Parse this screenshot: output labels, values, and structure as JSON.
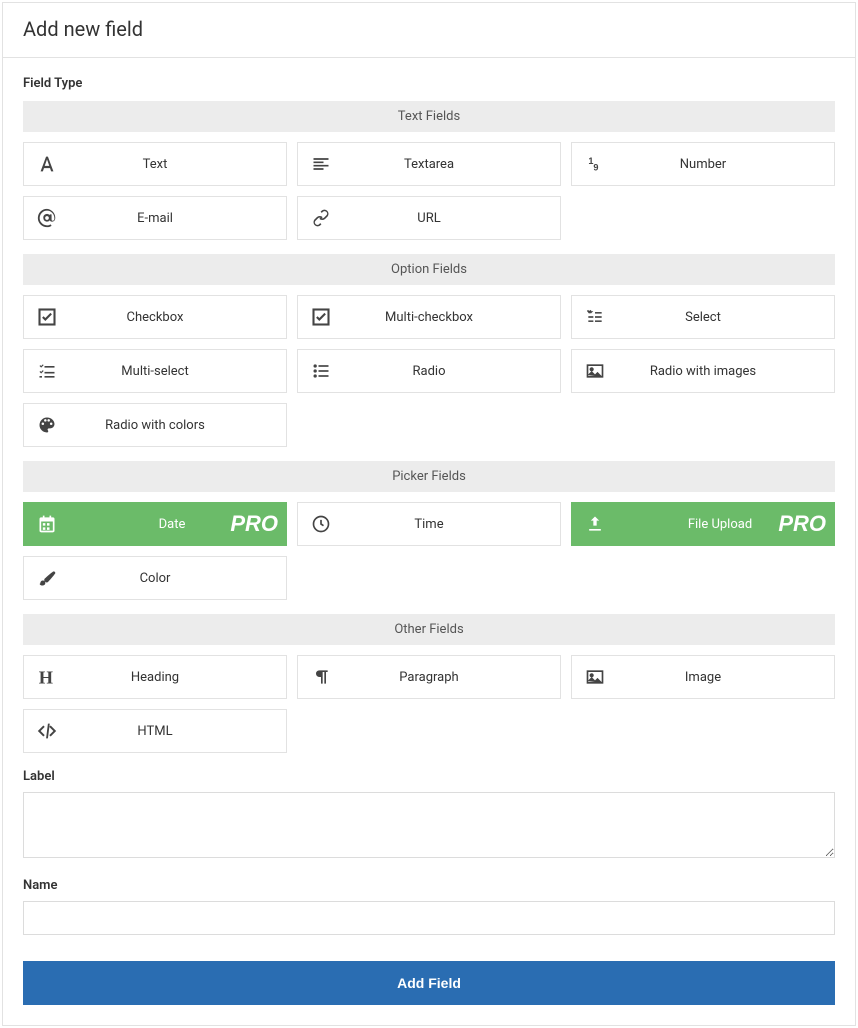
{
  "header": {
    "title": "Add new field"
  },
  "fieldTypeLabel": "Field Type",
  "groups": {
    "text": "Text Fields",
    "option": "Option Fields",
    "picker": "Picker Fields",
    "other": "Other Fields"
  },
  "tiles": {
    "text": "Text",
    "textarea": "Textarea",
    "number": "Number",
    "email": "E-mail",
    "url": "URL",
    "checkbox": "Checkbox",
    "multicheckbox": "Multi-checkbox",
    "select": "Select",
    "multiselect": "Multi-select",
    "radio": "Radio",
    "radioimages": "Radio with images",
    "radiocolors": "Radio with colors",
    "date": "Date",
    "time": "Time",
    "fileupload": "File Upload",
    "color": "Color",
    "heading": "Heading",
    "paragraph": "Paragraph",
    "image": "Image",
    "html": "HTML"
  },
  "proBadge": "PRO",
  "labelField": "Label",
  "nameField": "Name",
  "submit": "Add Field"
}
